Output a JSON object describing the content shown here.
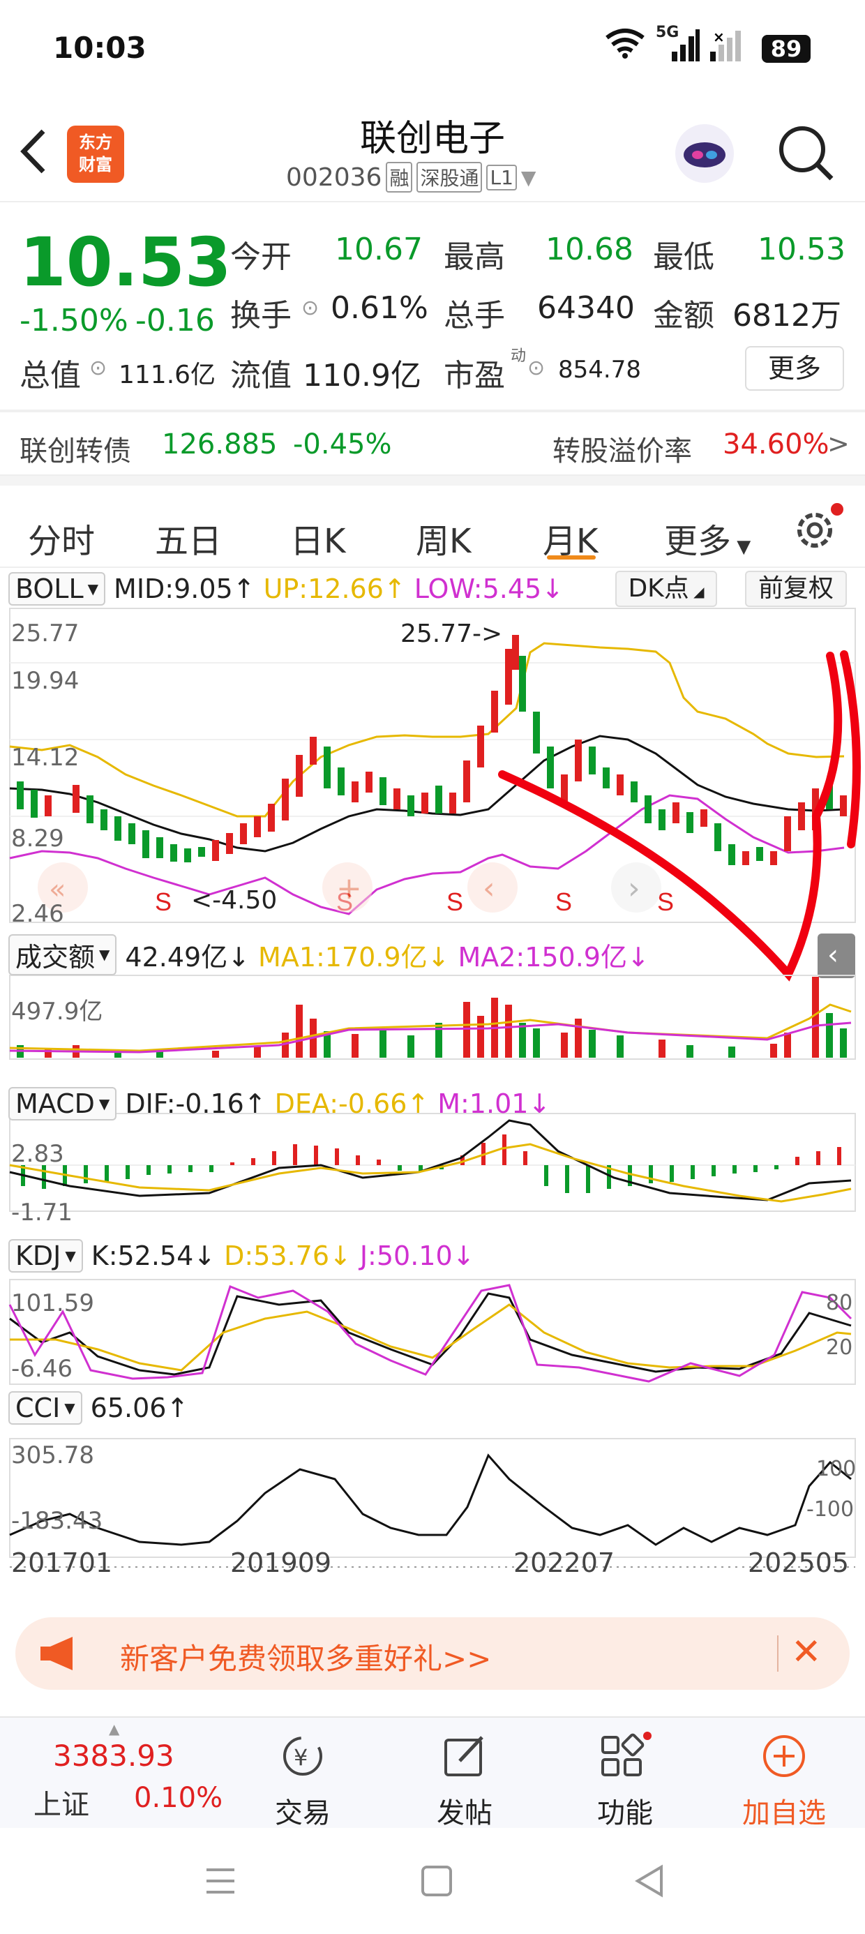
{
  "status_bar": {
    "time": "10:03",
    "network": "5G",
    "battery": "89"
  },
  "header": {
    "logo_line1": "东方",
    "logo_line2": "财富",
    "stock_name": "联创电子",
    "stock_code": "002036",
    "tag_rong": "融",
    "tag_sgt": "深股通",
    "tag_level": "L1"
  },
  "quote": {
    "price": "10.53",
    "change_pct": "-1.50%",
    "change": "-0.16",
    "open_label": "今开",
    "open": "10.67",
    "high_label": "最高",
    "high": "10.68",
    "low_label": "最低",
    "low": "10.53",
    "turnover_label": "换手",
    "turnover": "0.61%",
    "volume_label": "总手",
    "volume": "64340",
    "amount_label": "金额",
    "amount": "6812万",
    "mcap_label": "总值",
    "mcap": "111.6亿",
    "float_label": "流值",
    "float": "110.9亿",
    "pe_label": "市盈",
    "pe_sup": "动",
    "pe": "854.78",
    "more_button": "更多"
  },
  "bond": {
    "label": "联创转债",
    "price": "126.885",
    "change": "-0.45%",
    "premium_label": "转股溢价率",
    "premium": "34.60%"
  },
  "tabs": [
    "分时",
    "五日",
    "日K",
    "周K",
    "月K",
    "更多"
  ],
  "active_tab": "月K",
  "boll": {
    "name": "BOLL",
    "mid": "MID:9.05↑",
    "up": "UP:12.66↑",
    "low": "LOW:5.45↓",
    "dk_button": "DK点",
    "fq_button": "前复权",
    "y_labels": [
      "25.77",
      "19.94",
      "14.12",
      "8.29",
      "2.46"
    ],
    "max_label": "25.77->",
    "min_label": "<-4.50",
    "signal": "S"
  },
  "volume": {
    "name": "成交额",
    "value": "42.49亿↓",
    "ma1": "MA1:170.9亿↓",
    "ma2": "MA2:150.9亿↓",
    "y_label": "497.9亿"
  },
  "macd": {
    "name": "MACD",
    "dif": "DIF:-0.16↑",
    "dea": "DEA:-0.66↑",
    "m": "M:1.01↓",
    "y_top": "2.83",
    "y_bottom": "-1.71"
  },
  "kdj": {
    "name": "KDJ",
    "k": "K:52.54↓",
    "d": "D:53.76↓",
    "j": "J:50.10↓",
    "y_top": "101.59",
    "y_bottom": "-6.46",
    "ref_80": "80",
    "ref_20": "20"
  },
  "cci": {
    "name": "CCI",
    "value": "65.06↑",
    "y_top": "305.78",
    "y_bottom": "-183.43",
    "ref_100": "100",
    "ref_m100": "-100"
  },
  "x_axis": [
    "201701",
    "201909",
    "202207",
    "202505"
  ],
  "promo": {
    "text": "新客户免费领取多重好礼>>"
  },
  "bottom_nav": {
    "index_value": "3383.93",
    "index_name": "上证",
    "index_change": "0.10%",
    "trade": "交易",
    "post": "发帖",
    "func": "功能",
    "add": "加自选"
  },
  "colors": {
    "up": "#e02020",
    "down": "#0a9a2a",
    "accent": "#f08a1a",
    "mid_line": "#111111",
    "up_line": "#e6b800",
    "low_line": "#d030d0"
  }
}
